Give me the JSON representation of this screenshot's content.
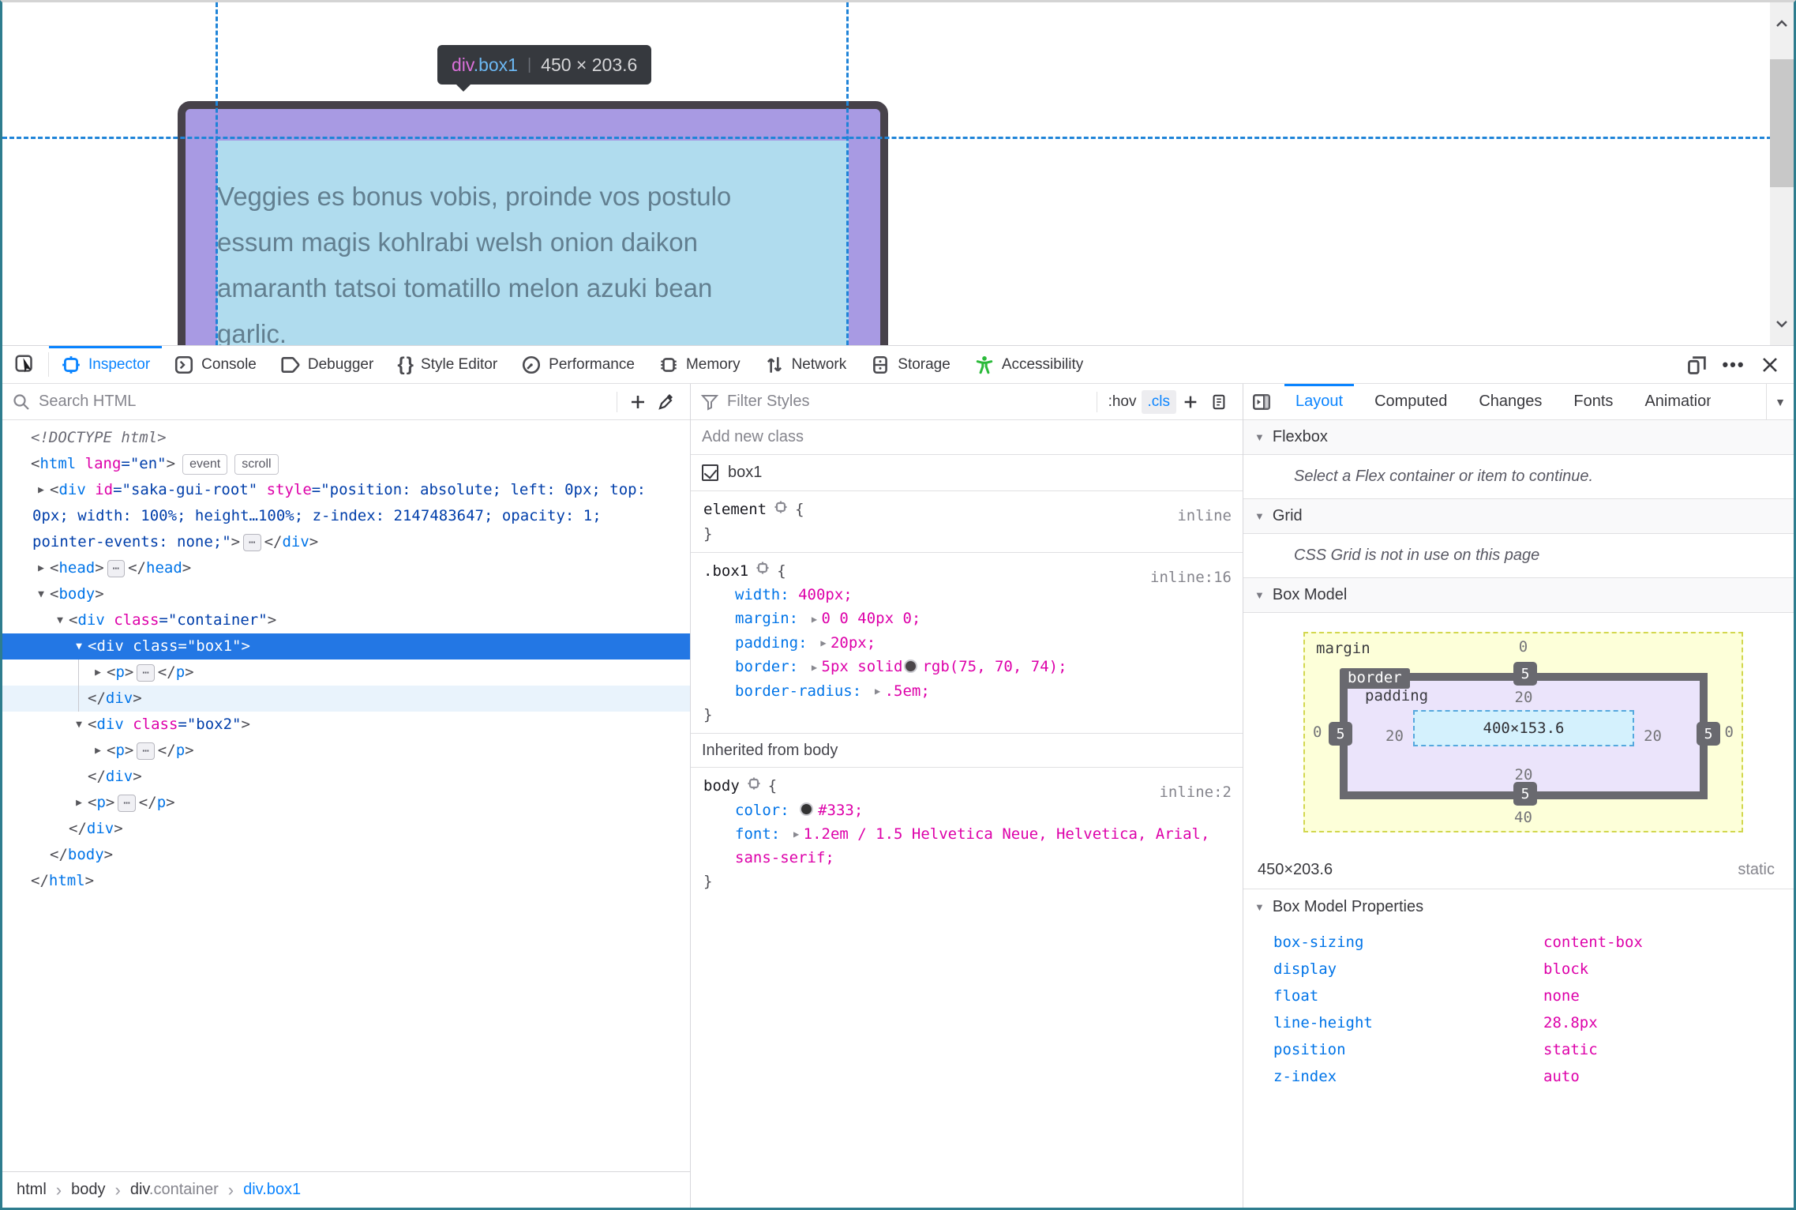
{
  "viewport": {
    "tooltip": {
      "tag": "div",
      "cls": ".box1",
      "separator": "|",
      "dims": "450 × 203.6"
    },
    "text_lines": [
      "Veggies es bonus vobis, proinde vos postulo",
      "essum magis kohlrabi welsh onion daikon",
      "amaranth tatsoi tomatillo melon azuki bean",
      "garlic."
    ]
  },
  "toolbar": {
    "tabs": [
      {
        "label": "Inspector",
        "active": true
      },
      {
        "label": "Console"
      },
      {
        "label": "Debugger"
      },
      {
        "label": "Style Editor"
      },
      {
        "label": "Performance"
      },
      {
        "label": "Memory"
      },
      {
        "label": "Network"
      },
      {
        "label": "Storage"
      },
      {
        "label": "Accessibility"
      }
    ]
  },
  "markup": {
    "search_placeholder": "Search HTML",
    "tree": [
      {
        "ind": 0,
        "tokens": [
          [
            "doctype",
            "<!DOCTYPE html>"
          ]
        ]
      },
      {
        "ind": 0,
        "tokens": [
          [
            "p",
            "<"
          ],
          [
            "tag",
            "html"
          ],
          [
            "attr",
            " lang"
          ],
          [
            "val",
            "=\"en\""
          ],
          [
            "p",
            ">"
          ],
          [
            "badge",
            "event"
          ],
          [
            "badge",
            "scroll"
          ]
        ]
      },
      {
        "ind": 1,
        "arrow": "r",
        "wrap": true,
        "tokens": [
          [
            "p",
            "<"
          ],
          [
            "tag",
            "div"
          ],
          [
            "attr",
            " id"
          ],
          [
            "val",
            "=\"saka-gui-root\""
          ],
          [
            "attr",
            " style"
          ],
          [
            "val",
            "=\"position: absolute; left: 0px; top: 0px; width: 100%; height…100%; z-index: 2147483647; opacity: 1; pointer-events: none;\""
          ],
          [
            "p",
            ">"
          ],
          [
            "dots",
            "⋯"
          ],
          [
            "p",
            "</"
          ],
          [
            "tag",
            "div"
          ],
          [
            "p",
            ">"
          ]
        ]
      },
      {
        "ind": 1,
        "arrow": "r",
        "tokens": [
          [
            "p",
            "<"
          ],
          [
            "tag",
            "head"
          ],
          [
            "p",
            ">"
          ],
          [
            "dots",
            "⋯"
          ],
          [
            "p",
            "</"
          ],
          [
            "tag",
            "head"
          ],
          [
            "p",
            ">"
          ]
        ]
      },
      {
        "ind": 1,
        "arrow": "d",
        "tokens": [
          [
            "p",
            "<"
          ],
          [
            "tag",
            "body"
          ],
          [
            "p",
            ">"
          ]
        ]
      },
      {
        "ind": 2,
        "arrow": "d",
        "tokens": [
          [
            "p",
            "<"
          ],
          [
            "tag",
            "div"
          ],
          [
            "attr",
            " class"
          ],
          [
            "val",
            "=\"container\""
          ],
          [
            "p",
            ">"
          ]
        ]
      },
      {
        "ind": 3,
        "arrow": "d",
        "sel": true,
        "tokens": [
          [
            "p",
            "<"
          ],
          [
            "tag",
            "div"
          ],
          [
            "attr",
            " class"
          ],
          [
            "val",
            "=\"box1\""
          ],
          [
            "p",
            ">"
          ]
        ]
      },
      {
        "ind": 4,
        "arrow": "r",
        "guided": true,
        "tokens": [
          [
            "p",
            "<"
          ],
          [
            "tag",
            "p"
          ],
          [
            "p",
            ">"
          ],
          [
            "dots",
            "⋯"
          ],
          [
            "p",
            "</"
          ],
          [
            "tag",
            "p"
          ],
          [
            "p",
            ">"
          ]
        ]
      },
      {
        "ind": 3,
        "close": true,
        "guided": true,
        "hl": true,
        "tokens": [
          [
            "p",
            "</"
          ],
          [
            "tag",
            "div"
          ],
          [
            "p",
            ">"
          ]
        ]
      },
      {
        "ind": 3,
        "arrow": "d",
        "tokens": [
          [
            "p",
            "<"
          ],
          [
            "tag",
            "div"
          ],
          [
            "attr",
            " class"
          ],
          [
            "val",
            "=\"box2\""
          ],
          [
            "p",
            ">"
          ]
        ]
      },
      {
        "ind": 4,
        "arrow": "r",
        "tokens": [
          [
            "p",
            "<"
          ],
          [
            "tag",
            "p"
          ],
          [
            "p",
            ">"
          ],
          [
            "dots",
            "⋯"
          ],
          [
            "p",
            "</"
          ],
          [
            "tag",
            "p"
          ],
          [
            "p",
            ">"
          ]
        ]
      },
      {
        "ind": 3,
        "close": true,
        "tokens": [
          [
            "p",
            "</"
          ],
          [
            "tag",
            "div"
          ],
          [
            "p",
            ">"
          ]
        ]
      },
      {
        "ind": 3,
        "arrow": "r",
        "tokens": [
          [
            "p",
            "<"
          ],
          [
            "tag",
            "p"
          ],
          [
            "p",
            ">"
          ],
          [
            "dots",
            "⋯"
          ],
          [
            "p",
            "</"
          ],
          [
            "tag",
            "p"
          ],
          [
            "p",
            ">"
          ]
        ]
      },
      {
        "ind": 2,
        "close": true,
        "tokens": [
          [
            "p",
            "</"
          ],
          [
            "tag",
            "div"
          ],
          [
            "p",
            ">"
          ]
        ]
      },
      {
        "ind": 1,
        "close": true,
        "tokens": [
          [
            "p",
            "</"
          ],
          [
            "tag",
            "body"
          ],
          [
            "p",
            ">"
          ]
        ]
      },
      {
        "ind": 0,
        "close": true,
        "tokens": [
          [
            "p",
            "</"
          ],
          [
            "tag",
            "html"
          ],
          [
            "p",
            ">"
          ]
        ]
      }
    ],
    "breadcrumb": [
      {
        "tag": "html"
      },
      {
        "tag": "body"
      },
      {
        "tag": "div",
        "cls": ".container"
      },
      {
        "tag": "div",
        "cls": ".box1",
        "active": true
      }
    ]
  },
  "rules": {
    "filter_placeholder": "Filter Styles",
    "hov": ":hov",
    "cls": ".cls",
    "add_class_placeholder": "Add new class",
    "class_toggle": "box1",
    "element_rule": {
      "selector": "element",
      "open": "{",
      "close": "}",
      "link": "inline"
    },
    "box1_rule": {
      "selector": ".box1",
      "open": "{",
      "close": "}",
      "link": "inline:16",
      "props": [
        {
          "name": "width",
          "value": "400px;"
        },
        {
          "name": "margin",
          "value": "0 0 40px 0;"
        },
        {
          "name": "padding",
          "value": "20px;"
        },
        {
          "name": "border",
          "value": "5px solid",
          "swatch": "#4b464a",
          "value2": "rgb(75, 70, 74);"
        },
        {
          "name": "border-radius",
          "value": ".5em;"
        }
      ]
    },
    "inherited_header": "Inherited from body",
    "body_rule": {
      "selector": "body",
      "open": "{",
      "close": "}",
      "link": "inline:2",
      "props": [
        {
          "name": "color",
          "swatch": "#333333",
          "value": "#333;"
        },
        {
          "name": "font",
          "value": "1.2em / 1.5 Helvetica Neue, Helvetica, Arial, sans-serif;"
        }
      ]
    }
  },
  "layout": {
    "tabs": [
      {
        "label": "Layout",
        "active": true
      },
      {
        "label": "Computed"
      },
      {
        "label": "Changes"
      },
      {
        "label": "Fonts"
      },
      {
        "label": "Animations"
      }
    ],
    "flexbox": {
      "title": "Flexbox",
      "message": "Select a Flex container or item to continue."
    },
    "grid": {
      "title": "Grid",
      "message": "CSS Grid is not in use on this page"
    },
    "boxmodel": {
      "title": "Box Model",
      "margin_label": "margin",
      "border_label": "border",
      "padding_label": "padding",
      "margin": {
        "top": "0",
        "right": "0",
        "bottom": "40",
        "left": "0"
      },
      "border": {
        "top": "5",
        "right": "5",
        "bottom": "5",
        "left": "5"
      },
      "padding": {
        "top": "20",
        "right": "20",
        "bottom": "20",
        "left": "20"
      },
      "content": "400×153.6",
      "dims": "450×203.6",
      "position": "static",
      "props_title": "Box Model Properties",
      "props": [
        {
          "name": "box-sizing",
          "value": "content-box"
        },
        {
          "name": "display",
          "value": "block"
        },
        {
          "name": "float",
          "value": "none"
        },
        {
          "name": "line-height",
          "value": "28.8px"
        },
        {
          "name": "position",
          "value": "static"
        },
        {
          "name": "z-index",
          "value": "auto"
        }
      ]
    }
  }
}
